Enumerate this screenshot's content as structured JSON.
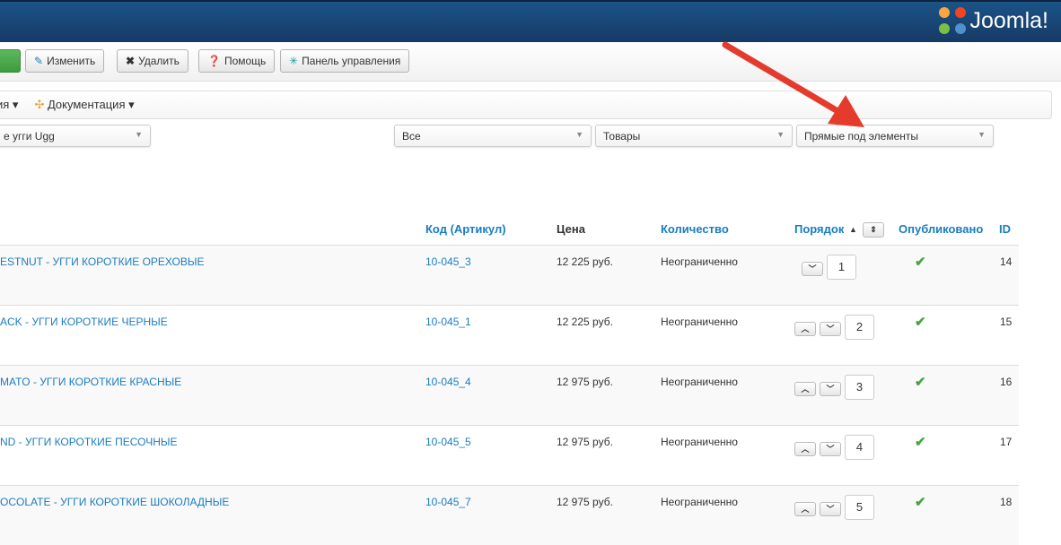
{
  "header": {
    "brand": "Joomla!"
  },
  "toolbar": {
    "edit": "Изменить",
    "delete": "Удалить",
    "help": "Помощь",
    "cpanel": "Панель управления"
  },
  "subnav": {
    "item1": "ия",
    "docs": "Документация"
  },
  "filters": {
    "category": "е угги Ugg",
    "f1": "Все",
    "f2": "Товары",
    "f3": "Прямые под элементы"
  },
  "table": {
    "headers": {
      "code": "Код (Артикул)",
      "price": "Цена",
      "qty": "Количество",
      "order": "Порядок",
      "published": "Опубликовано",
      "id": "ID"
    },
    "rows": [
      {
        "name": "ESTNUT - УГГИ КОРОТКИЕ ОРЕХОВЫЕ",
        "code": "10-045_3",
        "price": "12 225 руб.",
        "qty": "Неограниченно",
        "order": "1",
        "id": "14"
      },
      {
        "name": "ACK - УГГИ КОРОТКИЕ ЧЕРНЫЕ",
        "code": "10-045_1",
        "price": "12 225 руб.",
        "qty": "Неограниченно",
        "order": "2",
        "id": "15"
      },
      {
        "name": "MATO - УГГИ КОРОТКИЕ КРАСНЫЕ",
        "code": "10-045_4",
        "price": "12 975 руб.",
        "qty": "Неограниченно",
        "order": "3",
        "id": "16"
      },
      {
        "name": "ND - УГГИ КОРОТКИЕ ПЕСОЧНЫЕ",
        "code": "10-045_5",
        "price": "12 975 руб.",
        "qty": "Неограниченно",
        "order": "4",
        "id": "17"
      },
      {
        "name": "OCOLATE - УГГИ КОРОТКИЕ ШОКОЛАДНЫЕ",
        "code": "10-045_7",
        "price": "12 975 руб.",
        "qty": "Неограниченно",
        "order": "5",
        "id": "18"
      }
    ]
  }
}
